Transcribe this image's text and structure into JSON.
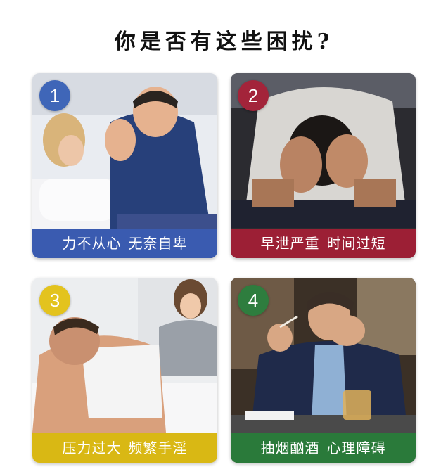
{
  "title": "你是否有这些困扰?",
  "cards": [
    {
      "number": "1",
      "caption_left": "力不从心",
      "caption_right": "无奈自卑",
      "badge_color": "#3f66b8",
      "caption_color": "#3a5bb0"
    },
    {
      "number": "2",
      "caption_left": "早泄严重",
      "caption_right": "时间过短",
      "badge_color": "#a3243a",
      "caption_color": "#9c1f35"
    },
    {
      "number": "3",
      "caption_left": "压力过大",
      "caption_right": "频繁手淫",
      "badge_color": "#e3c31e",
      "caption_color": "#d9b814"
    },
    {
      "number": "4",
      "caption_left": "抽烟酗酒",
      "caption_right": "心理障碍",
      "badge_color": "#2e7d3e",
      "caption_color": "#2a7a3a"
    }
  ]
}
